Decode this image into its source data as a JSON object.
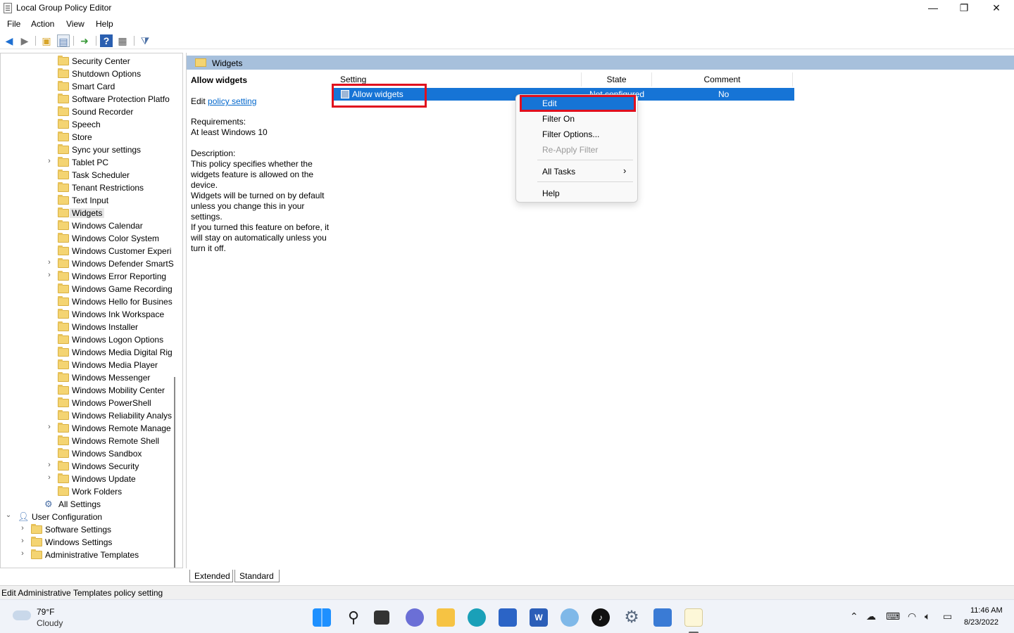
{
  "window": {
    "title": "Local Group Policy Editor",
    "minimize": "—",
    "maximize": "❐",
    "close": "✕"
  },
  "menu": [
    "File",
    "Action",
    "View",
    "Help"
  ],
  "tree": {
    "items": [
      {
        "label": "Security Center",
        "expandable": false
      },
      {
        "label": "Shutdown Options",
        "expandable": false
      },
      {
        "label": "Smart Card",
        "expandable": false
      },
      {
        "label": "Software Protection Platfo",
        "expandable": false
      },
      {
        "label": "Sound Recorder",
        "expandable": false
      },
      {
        "label": "Speech",
        "expandable": false
      },
      {
        "label": "Store",
        "expandable": false
      },
      {
        "label": "Sync your settings",
        "expandable": false
      },
      {
        "label": "Tablet PC",
        "expandable": true
      },
      {
        "label": "Task Scheduler",
        "expandable": false
      },
      {
        "label": "Tenant Restrictions",
        "expandable": false
      },
      {
        "label": "Text Input",
        "expandable": false
      },
      {
        "label": "Widgets",
        "expandable": false,
        "selected": true
      },
      {
        "label": "Windows Calendar",
        "expandable": false
      },
      {
        "label": "Windows Color System",
        "expandable": false
      },
      {
        "label": "Windows Customer Experi",
        "expandable": false
      },
      {
        "label": "Windows Defender SmartS",
        "expandable": true
      },
      {
        "label": "Windows Error Reporting",
        "expandable": true
      },
      {
        "label": "Windows Game Recording",
        "expandable": false
      },
      {
        "label": "Windows Hello for Busines",
        "expandable": false
      },
      {
        "label": "Windows Ink Workspace",
        "expandable": false
      },
      {
        "label": "Windows Installer",
        "expandable": false
      },
      {
        "label": "Windows Logon Options",
        "expandable": false
      },
      {
        "label": "Windows Media Digital Rig",
        "expandable": false
      },
      {
        "label": "Windows Media Player",
        "expandable": false
      },
      {
        "label": "Windows Messenger",
        "expandable": false
      },
      {
        "label": "Windows Mobility Center",
        "expandable": false
      },
      {
        "label": "Windows PowerShell",
        "expandable": false
      },
      {
        "label": "Windows Reliability Analys",
        "expandable": false
      },
      {
        "label": "Windows Remote Manage",
        "expandable": true
      },
      {
        "label": "Windows Remote Shell",
        "expandable": false
      },
      {
        "label": "Windows Sandbox",
        "expandable": false
      },
      {
        "label": "Windows Security",
        "expandable": true
      },
      {
        "label": "Windows Update",
        "expandable": true
      },
      {
        "label": "Work Folders",
        "expandable": false
      }
    ],
    "all_settings": "All Settings",
    "user_configuration": "User Configuration",
    "user_children": [
      "Software Settings",
      "Windows Settings",
      "Administrative Templates"
    ]
  },
  "right_pane": {
    "header": "Widgets",
    "desc": {
      "heading": "Allow widgets",
      "edit_prefix": "Edit ",
      "edit_link": "policy setting ",
      "req_label": "Requirements:",
      "req_value": "At least Windows 10",
      "desc_label": "Description:",
      "desc_p1": "This policy specifies whether the widgets feature is allowed on the device.",
      "desc_p2": "Widgets will be turned on by default unless you change this in your settings.",
      "desc_p3": "If you turned this feature on before, it will stay on automatically unless you turn it off."
    },
    "columns": {
      "setting": "Setting",
      "state": "State",
      "comment": "Comment"
    },
    "row": {
      "setting": "Allow widgets",
      "state": "Not configured",
      "comment": "No"
    }
  },
  "context_menu": {
    "edit": "Edit",
    "filter_on": "Filter On",
    "filter_options": "Filter Options...",
    "reapply": "Re-Apply Filter",
    "all_tasks": "All Tasks",
    "help": "Help"
  },
  "tabs": [
    "Extended",
    "Standard"
  ],
  "status": "Edit Administrative Templates policy setting",
  "taskbar": {
    "temp": "79°F",
    "condition": "Cloudy",
    "time": "11:46 AM",
    "date": "8/23/2022"
  },
  "colors": {
    "selection": "#1674d6",
    "header": "#a7c0dc",
    "highlight_box": "#e0101e"
  }
}
